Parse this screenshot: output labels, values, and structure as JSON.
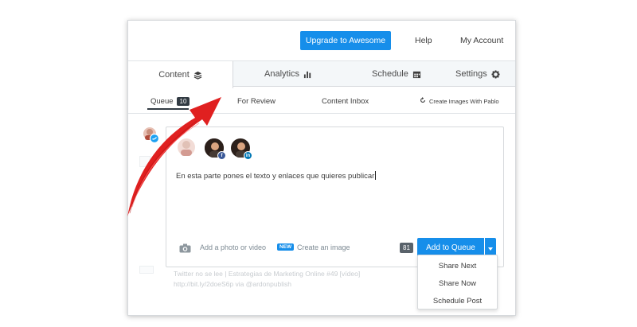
{
  "header": {
    "upgrade_label": "Upgrade to Awesome",
    "help_label": "Help",
    "account_label": "My Account"
  },
  "tabs": [
    {
      "label": "Content",
      "icon": "layers-icon",
      "active": true
    },
    {
      "label": "Analytics",
      "icon": "bar-chart-icon",
      "active": false
    },
    {
      "label": "Schedule",
      "icon": "calendar-icon",
      "active": false
    },
    {
      "label": "Settings",
      "icon": "gear-icon",
      "active": false
    }
  ],
  "subtabs": {
    "queue_label": "Queue",
    "queue_count": "10",
    "review_label": "For Review",
    "inbox_label": "Content Inbox",
    "pablo_label": "Create Images With Pablo"
  },
  "composer": {
    "text": "En esta parte pones el texto y enlaces que quieres publicar",
    "add_photo_label": "Add a photo or video",
    "new_badge": "NEW",
    "create_image_label": "Create an image",
    "char_count": "81",
    "add_to_queue_label": "Add to Queue",
    "accounts": [
      {
        "network": "twitter",
        "color": "#1da1f2"
      },
      {
        "network": "facebook",
        "color": "#3b5998"
      },
      {
        "network": "linkedin",
        "color": "#0077b5"
      }
    ]
  },
  "dropdown": {
    "items": [
      "Share Next",
      "Share Now",
      "Schedule Post"
    ]
  },
  "background_post": {
    "line1": "Twitter no se lee | Estrategias de Marketing Online #49 [vídeo]",
    "line2": "http://bit.ly/2doeS6p via @ardonpublish"
  },
  "colors": {
    "accent": "#168eea",
    "arrow": "#e02020",
    "dark_badge": "#323b43"
  }
}
